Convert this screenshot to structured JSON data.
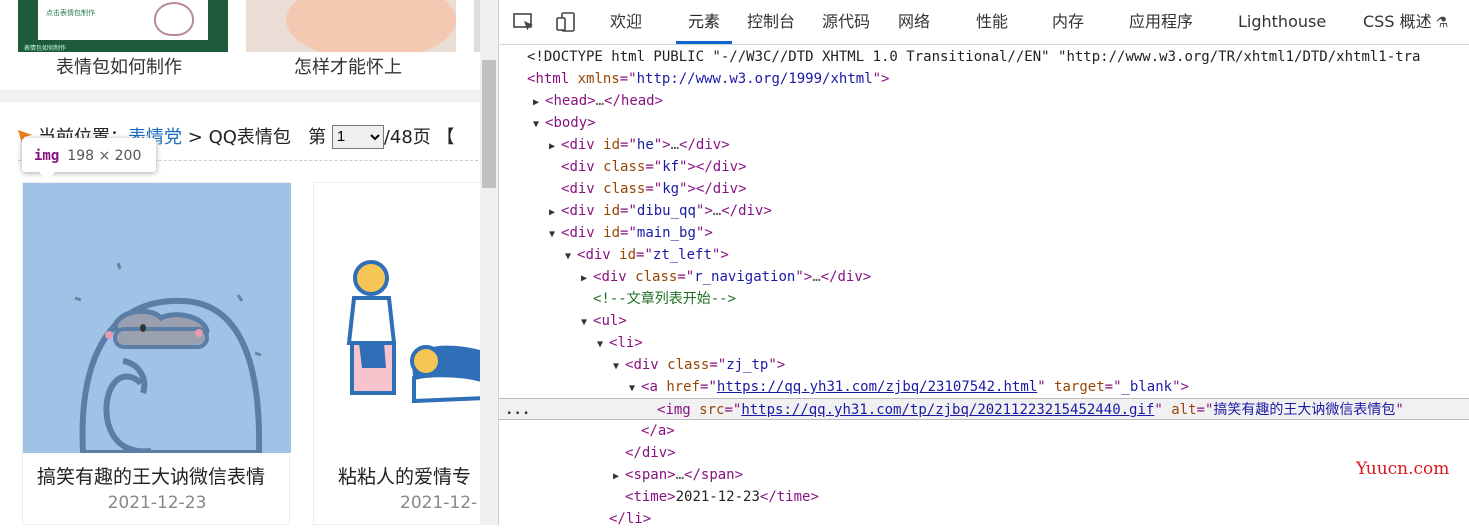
{
  "webpage": {
    "top_items": [
      {
        "label": "表情包如何制作",
        "thumb_text": "点击表情包制作",
        "thumb_caption": "表情包如何制作"
      },
      {
        "label": "怎样才能怀上"
      }
    ],
    "breadcrumb": {
      "prefix": "当前位置：",
      "link": "表情党",
      "separator": ">",
      "current": "QQ表情包",
      "page_prefix": "第",
      "page_value": "1",
      "page_suffix": "/48页",
      "bracket": "【"
    },
    "tooltip": {
      "tag": "img",
      "dimensions": "198 × 200"
    },
    "cards": [
      {
        "title": "搞笑有趣的王大讷微信表情",
        "date": "2021-12-23"
      },
      {
        "title": "粘粘人的爱情专",
        "date": "2021-12-"
      }
    ]
  },
  "devtools": {
    "tabs": [
      {
        "label": "欢迎"
      },
      {
        "label": "元素",
        "active": true
      },
      {
        "label": "控制台"
      },
      {
        "label": "源代码"
      },
      {
        "label": "网络"
      },
      {
        "label": "性能"
      },
      {
        "label": "内存"
      },
      {
        "label": "应用程序"
      },
      {
        "label": "Lighthouse"
      },
      {
        "label": "CSS 概述"
      }
    ],
    "dom": {
      "doctype": "<!DOCTYPE html PUBLIC \"-//W3C//DTD XHTML 1.0 Transitional//EN\" \"http://www.w3.org/TR/xhtml1/DTD/xhtml1-tra",
      "html_tag": "html",
      "html_attr": "xmlns",
      "html_val": "http://www.w3.org/1999/xhtml",
      "head": "head",
      "body": "body",
      "div": "div",
      "id": "id",
      "class": "class",
      "ul": "ul",
      "li": "li",
      "a": "a",
      "img": "img",
      "span": "span",
      "time": "time",
      "he": "he",
      "kf": "kf",
      "kg": "kg",
      "dibu": "dibu_qq",
      "main": "main_bg",
      "ztleft": "zt_left",
      "rnav": "r_navigation",
      "comment": "<!--文章列表开始-->",
      "zjtp": "zj_tp",
      "href_attr": "href",
      "href_val": "https://qq.yh31.com/zjbq/23107542.html",
      "target_attr": "target",
      "target_val": "_blank",
      "src_attr": "src",
      "src_val": "https://qq.yh31.com/tp/zjbq/20211223215452440.gif",
      "alt_attr": "alt",
      "alt_val": "搞笑有趣的王大讷微信表情包",
      "time_text": "2021-12-23",
      "ellipsis": "…",
      "dots": "..."
    },
    "watermark": "Yuucn.com"
  },
  "colors": {
    "tag": "#881280",
    "attr_name": "#994500",
    "attr_value": "#1a1aa6",
    "comment": "#236e25",
    "active_tab_underline": "#0a64d0",
    "link": "#1b6fc2",
    "watermark": "#d9181c"
  }
}
